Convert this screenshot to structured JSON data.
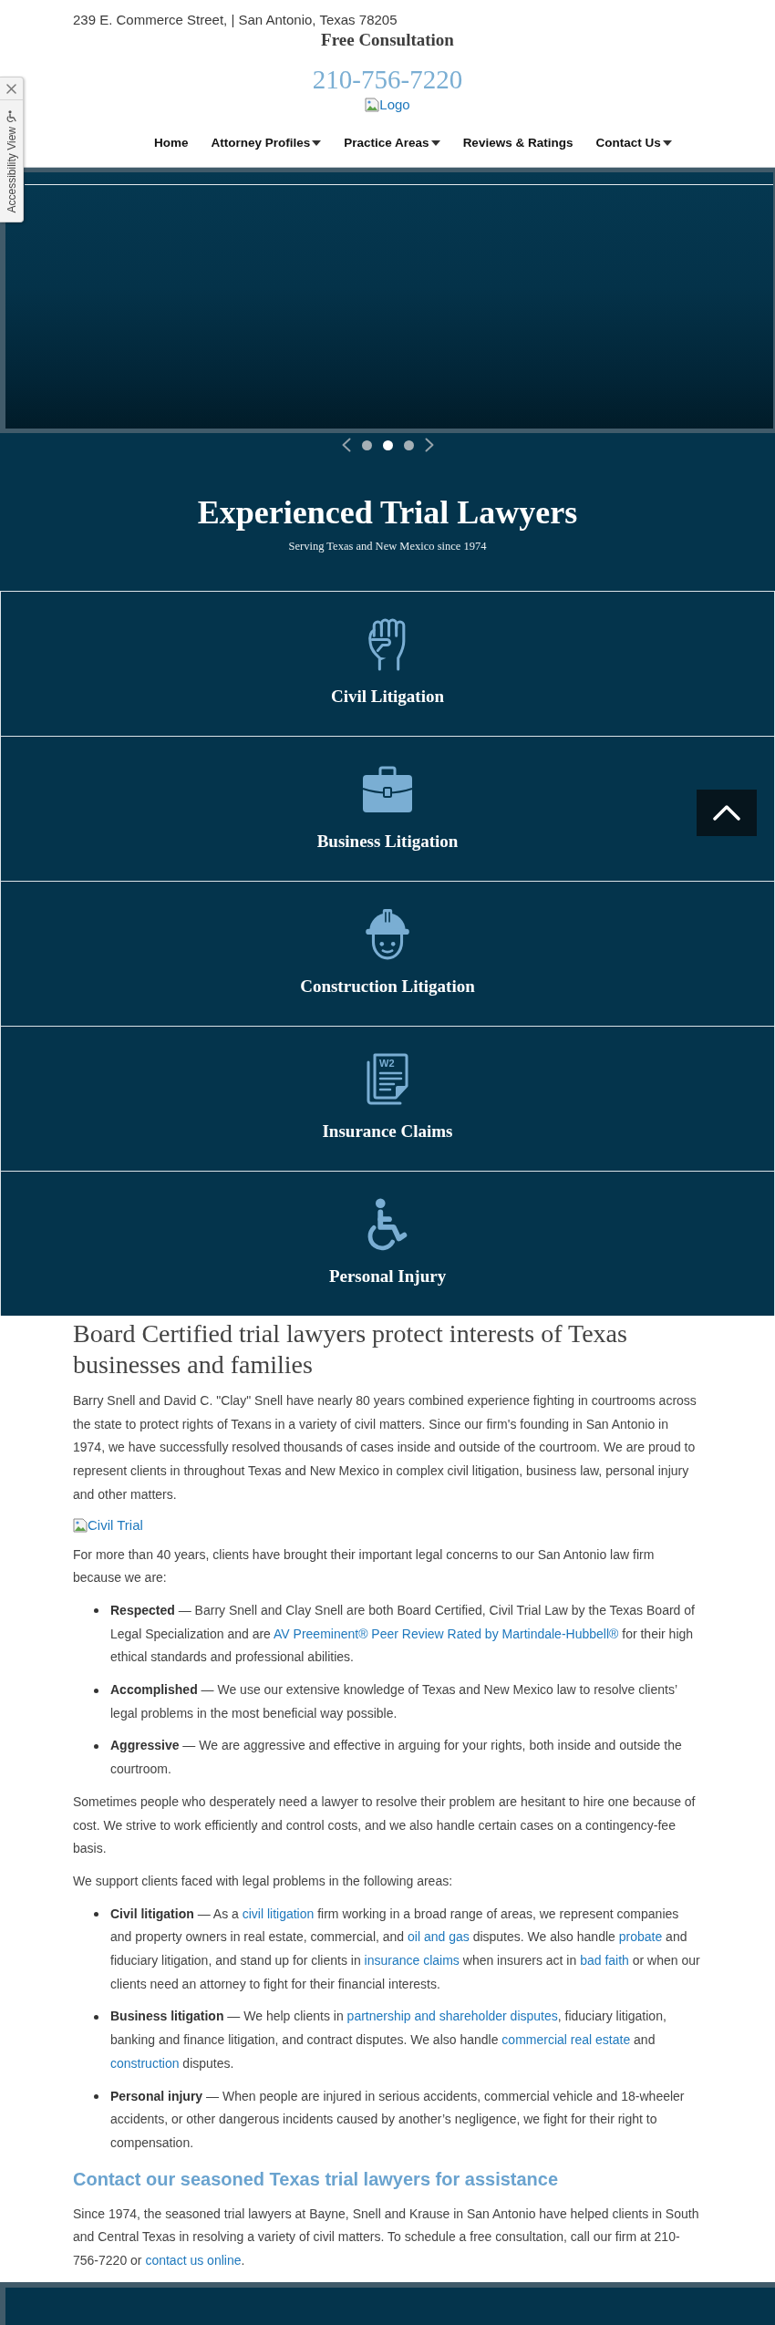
{
  "accessibility_panel": {
    "label": "Accessibility View"
  },
  "header": {
    "address": "239 E. Commerce Street, | San Antonio, Texas 78205",
    "tagline": "Free Consultation",
    "phone": "210-756-7220",
    "logo_alt": "Logo"
  },
  "nav": [
    {
      "label": "Home",
      "dropdown": false
    },
    {
      "label": "Attorney Profiles",
      "dropdown": true
    },
    {
      "label": "Practice Areas",
      "dropdown": true
    },
    {
      "label": "Reviews & Ratings",
      "dropdown": false
    },
    {
      "label": "Contact Us",
      "dropdown": true
    }
  ],
  "slider": {
    "dots": [
      {
        "selected": false
      },
      {
        "selected": true
      },
      {
        "selected": false
      }
    ]
  },
  "hero": {
    "title": "Experienced Trial Lawyers",
    "subtitle": "Serving Texas and New Mexico since 1974"
  },
  "practice_areas": [
    {
      "kind": "fist",
      "label": "Civil Litigation"
    },
    {
      "kind": "briefcase",
      "label": "Business Litigation"
    },
    {
      "kind": "worker",
      "label": "Construction Litigation"
    },
    {
      "kind": "form",
      "label": "Insurance Claims",
      "icon_text": "W2"
    },
    {
      "kind": "wheelchair",
      "label": "Personal Injury"
    }
  ],
  "content": {
    "heading": "Board Certified trial lawyers protect interests of Texas businesses and families",
    "blocks": [
      {
        "kind": "paragraph",
        "segments": [
          {
            "kind": "text",
            "text": "Barry Snell and David C. \"Clay\" Snell have nearly 80 years combined experience fighting in courtrooms across the state to protect rights of Texans in a variety of civil matters. Since our firm's founding in San Antonio in 1974, we have successfully resolved thousands of cases inside and outside of the courtroom. We are proud to represent clients in throughout Texas and New Mexico in complex civil litigation, business law, personal injury and other matters."
          }
        ]
      },
      {
        "kind": "image",
        "alt_text": "Civil Trial"
      },
      {
        "kind": "paragraph",
        "segments": [
          {
            "kind": "text",
            "text": "For more than 40 years, clients have brought their important legal concerns to our San Antonio law firm because we are:"
          }
        ]
      },
      {
        "kind": "list",
        "items": [
          {
            "segments": [
              {
                "kind": "text",
                "text": "**Respected** — Barry Snell and Clay Snell are both Board Certified, Civil Trial Law by the Texas Board of Legal Specialization and are "
              },
              {
                "kind": "link",
                "text": "AV Preeminent® Peer Review Rated by Martindale-Hubbell®"
              },
              {
                "kind": "text",
                "text": " for their high ethical standards and professional abilities."
              }
            ]
          },
          {
            "segments": [
              {
                "kind": "text",
                "text": "**Accomplished** — We use our extensive knowledge of Texas and New Mexico law to resolve clients’ legal problems in the most beneficial way possible."
              }
            ]
          },
          {
            "segments": [
              {
                "kind": "text",
                "text": "**Aggressive** — We are aggressive and effective in arguing for your rights, both inside and outside the courtroom."
              }
            ]
          }
        ]
      },
      {
        "kind": "paragraph",
        "segments": [
          {
            "kind": "text",
            "text": "Sometimes people who desperately need a lawyer to resolve their problem are hesitant to hire one because of cost. We strive to work efficiently and control costs, and we also handle certain cases on a contingency-fee basis."
          }
        ]
      },
      {
        "kind": "paragraph",
        "segments": [
          {
            "kind": "text",
            "text": "We support clients faced with legal problems in the following areas:"
          }
        ]
      },
      {
        "kind": "list",
        "items": [
          {
            "segments": [
              {
                "kind": "text",
                "text": "**Civil litigation** — As a "
              },
              {
                "kind": "link",
                "text": "civil litigation"
              },
              {
                "kind": "text",
                "text": " firm working in a broad range of areas, we represent companies and property owners in real estate, commercial, and "
              },
              {
                "kind": "link",
                "text": "oil and gas"
              },
              {
                "kind": "text",
                "text": " disputes. We also handle "
              },
              {
                "kind": "link",
                "text": "probate"
              },
              {
                "kind": "text",
                "text": " and fiduciary litigation, and stand up for clients in "
              },
              {
                "kind": "link",
                "text": "insurance claims"
              },
              {
                "kind": "text",
                "text": " when insurers act in "
              },
              {
                "kind": "link",
                "text": "bad faith"
              },
              {
                "kind": "text",
                "text": " or when our clients need an attorney to fight for their financial interests."
              }
            ]
          },
          {
            "segments": [
              {
                "kind": "text",
                "text": "**Business litigation** — We help clients in "
              },
              {
                "kind": "link",
                "text": "partnership and shareholder disputes"
              },
              {
                "kind": "text",
                "text": ", fiduciary litigation, banking and finance litigation, and contract disputes. We also handle "
              },
              {
                "kind": "link",
                "text": "commercial real estate"
              },
              {
                "kind": "text",
                "text": " and "
              },
              {
                "kind": "link",
                "text": "construction"
              },
              {
                "kind": "text",
                "text": " disputes."
              }
            ]
          },
          {
            "segments": [
              {
                "kind": "text",
                "text": "**Personal injury** — When people are injured in serious accidents, commercial vehicle and 18-wheeler accidents, or other dangerous incidents caused by another’s negligence, we fight for their right to compensation."
              }
            ]
          }
        ]
      },
      {
        "kind": "subheading",
        "text": "Contact our seasoned Texas trial lawyers for assistance"
      },
      {
        "kind": "paragraph",
        "segments": [
          {
            "kind": "text",
            "text": "Since 1974, the seasoned trial lawyers at Bayne, Snell and Krause in San Antonio have helped clients in South and Central Texas in resolving a variety of civil matters. To schedule a free consultation, call our firm at 210-756-7220 or "
          },
          {
            "kind": "link",
            "text": "contact us online"
          },
          {
            "kind": "text",
            "text": "."
          }
        ]
      }
    ]
  }
}
